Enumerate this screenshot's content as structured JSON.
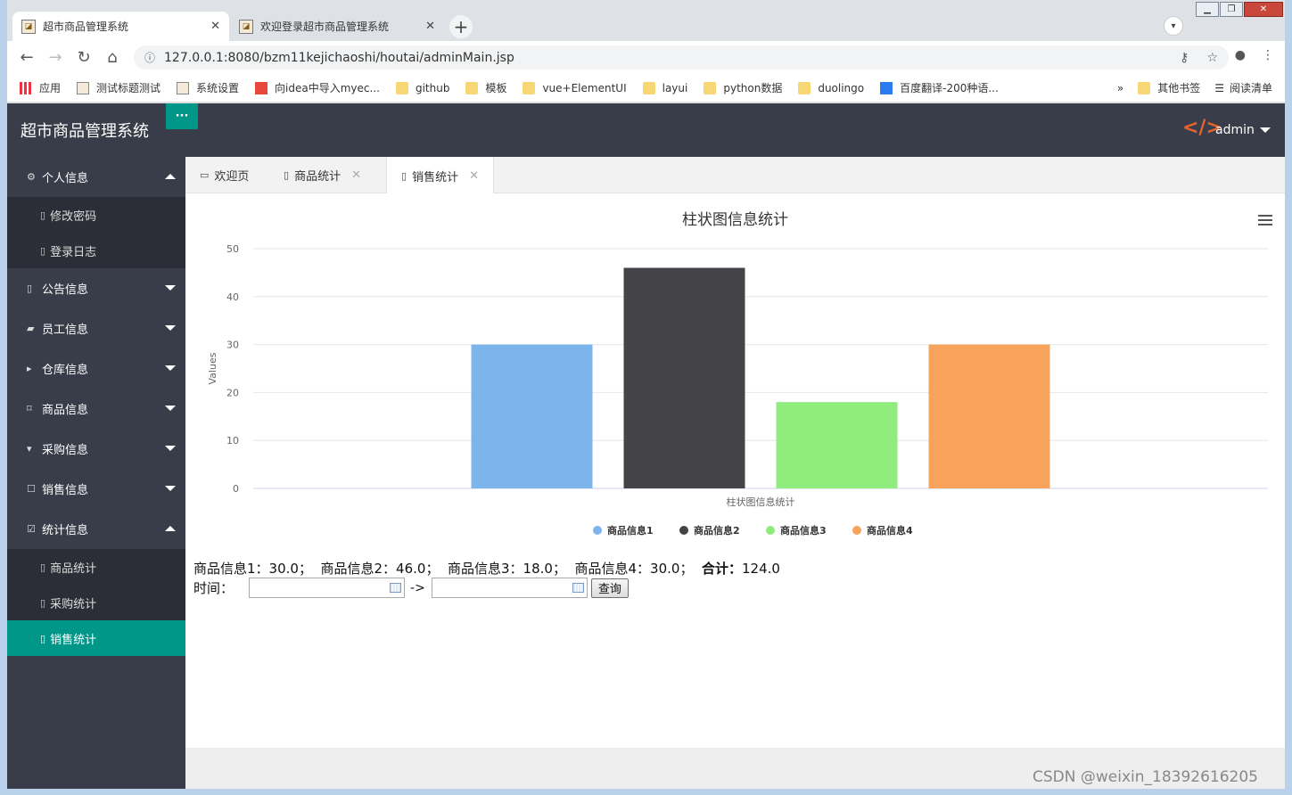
{
  "browser": {
    "tabs": [
      {
        "title": "超市商品管理系统",
        "active": true
      },
      {
        "title": "欢迎登录超市商品管理系统",
        "active": false
      }
    ],
    "url": "127.0.0.1:8080/bzm11kejichaoshi/houtai/adminMain.jsp",
    "bookmarks": [
      "应用",
      "测试标题测试",
      "系统设置",
      "向idea中导入myec...",
      "github",
      "模板",
      "vue+ElementUI",
      "layui",
      "python数据",
      "duolingo",
      "百度翻译-200种语..."
    ],
    "bookmarks_more": "»",
    "other_bookmarks": "其他书签",
    "reading_list": "阅读清单"
  },
  "app": {
    "title": "超市商品管理系统",
    "user": "admin",
    "menu_toggle": "···"
  },
  "sidebar": [
    {
      "label": "个人信息",
      "icon": "gear-icon",
      "expanded": true,
      "children": [
        {
          "label": "修改密码"
        },
        {
          "label": "登录日志"
        }
      ]
    },
    {
      "label": "公告信息",
      "icon": "file-icon",
      "expanded": false
    },
    {
      "label": "员工信息",
      "icon": "folder-icon",
      "expanded": false
    },
    {
      "label": "仓库信息",
      "icon": "triangle-right-icon",
      "expanded": false
    },
    {
      "label": "商品信息",
      "icon": "tag-icon",
      "expanded": false
    },
    {
      "label": "采购信息",
      "icon": "triangle-down-icon",
      "expanded": false
    },
    {
      "label": "销售信息",
      "icon": "square-icon",
      "expanded": false
    },
    {
      "label": "统计信息",
      "icon": "checkbox-icon",
      "expanded": true,
      "children": [
        {
          "label": "商品统计"
        },
        {
          "label": "采购统计"
        },
        {
          "label": "销售统计",
          "active": true
        }
      ]
    }
  ],
  "page_tabs": [
    {
      "label": "欢迎页",
      "closable": false
    },
    {
      "label": "商品统计",
      "closable": true
    },
    {
      "label": "销售统计",
      "closable": true,
      "active": true
    }
  ],
  "chart_data": {
    "type": "bar",
    "title": "柱状图信息统计",
    "xlabel": "柱状图信息统计",
    "ylabel": "Values",
    "ylim": [
      0,
      50
    ],
    "yticks": [
      0,
      10,
      20,
      30,
      40,
      50
    ],
    "legend_position": "bottom",
    "series": [
      {
        "name": "商品信息1",
        "values": [
          30
        ],
        "color": "#7cb5ec"
      },
      {
        "name": "商品信息2",
        "values": [
          46
        ],
        "color": "#434348"
      },
      {
        "name": "商品信息3",
        "values": [
          18
        ],
        "color": "#90ed7d"
      },
      {
        "name": "商品信息4",
        "values": [
          30
        ],
        "color": "#f7a35c"
      }
    ]
  },
  "summary": {
    "items": [
      "商品信息1：30.0；",
      "商品信息2：46.0；",
      "商品信息3：18.0；",
      "商品信息4：30.0；"
    ],
    "total_label": "合计：",
    "total_value": "124.0"
  },
  "filter": {
    "time_label": "时间：",
    "separator": "->",
    "start_value": "",
    "end_value": "",
    "query_label": "查询"
  },
  "watermark": "CSDN @weixin_18392616205"
}
